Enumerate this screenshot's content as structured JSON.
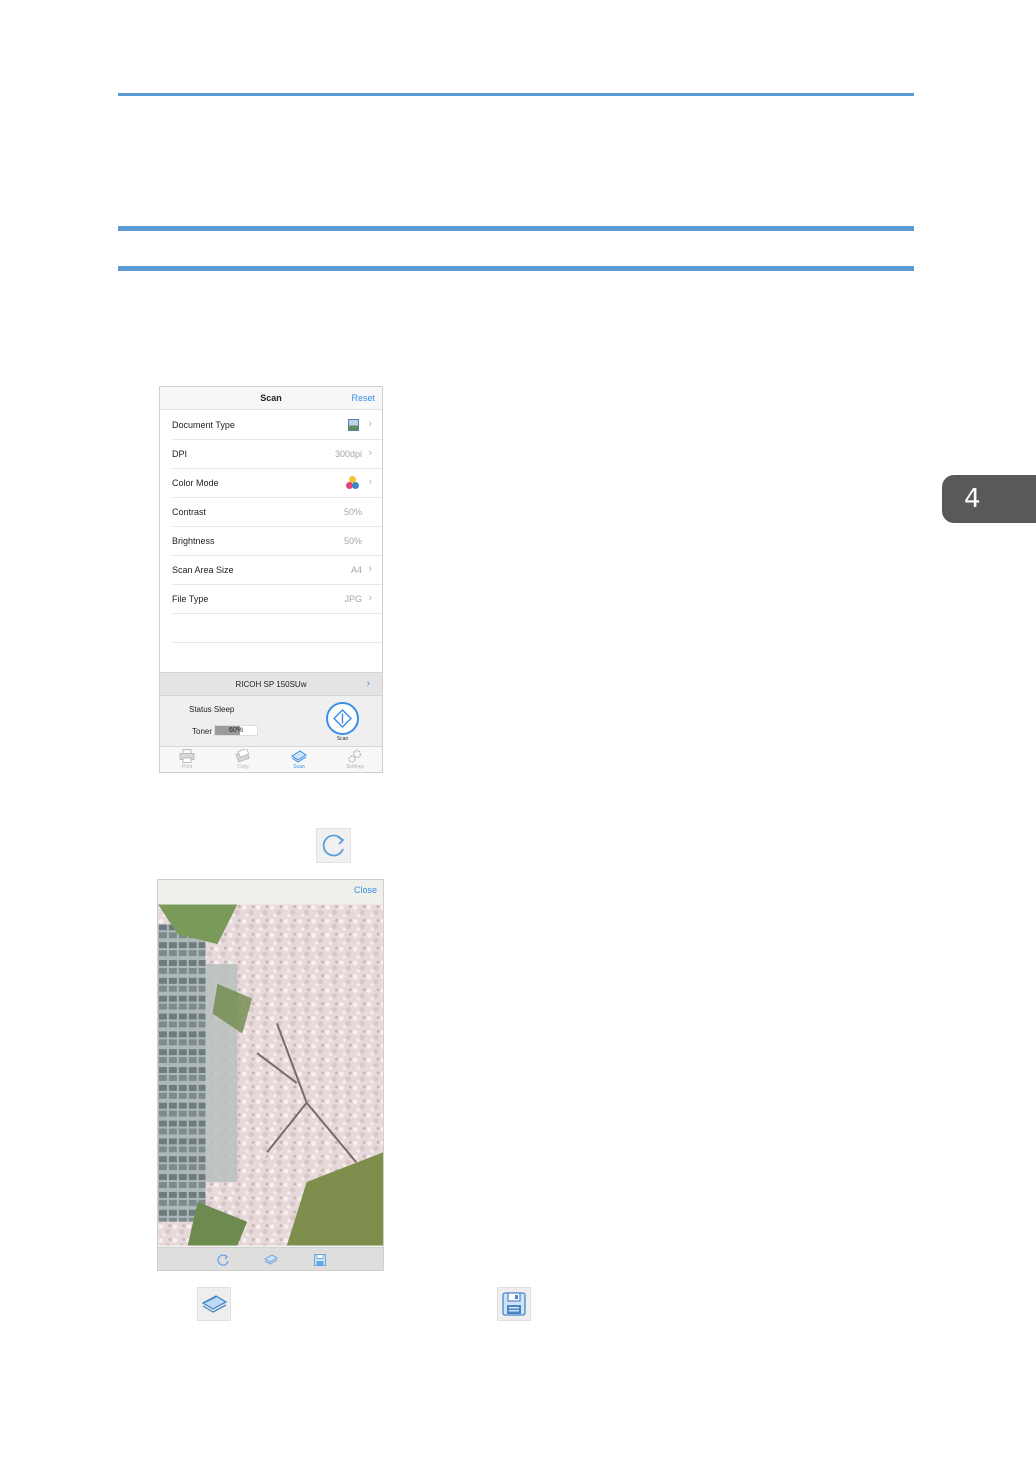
{
  "chapter": {
    "number": "4"
  },
  "scan_screen": {
    "title": "Scan",
    "reset_label": "Reset",
    "settings": [
      {
        "label": "Document Type",
        "value": "",
        "icon": "photo-document-icon"
      },
      {
        "label": "DPI",
        "value": "300dpi"
      },
      {
        "label": "Color Mode",
        "value": "",
        "icon": "color-mode-icon"
      },
      {
        "label": "Contrast",
        "value": "50%"
      },
      {
        "label": "Brightness",
        "value": "50%"
      },
      {
        "label": "Scan Area Size",
        "value": "A4"
      },
      {
        "label": "File Type",
        "value": "JPG"
      }
    ],
    "printer_name": "RICOH SP 150SUw",
    "status_text": "Status Sleep",
    "toner_label": "Toner",
    "toner_value": "60%",
    "toner_fraction": 0.6,
    "scan_button_label": "Scan",
    "tabs": [
      {
        "label": "Print",
        "icon": "printer-icon",
        "active": false
      },
      {
        "label": "Copy",
        "icon": "copy-icon",
        "active": false
      },
      {
        "label": "Scan",
        "icon": "scanner-icon",
        "active": true
      },
      {
        "label": "Settings",
        "icon": "gears-icon",
        "active": false
      }
    ],
    "accent_color": "#3a8ee6"
  },
  "preview_screen": {
    "close_label": "Close",
    "toolbar_icons": [
      "rotate-icon",
      "rescan-icon",
      "save-icon"
    ]
  }
}
